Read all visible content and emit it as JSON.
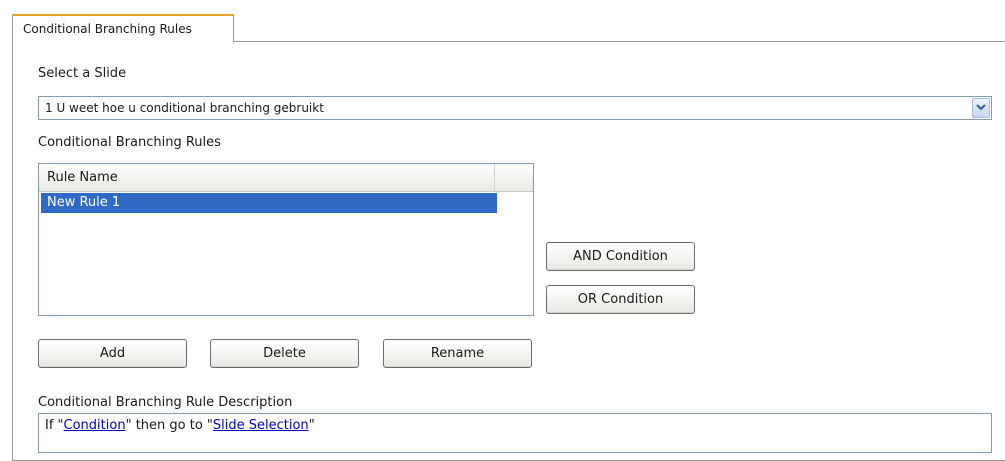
{
  "tab": {
    "label": "Conditional Branching Rules"
  },
  "slide": {
    "label": "Select a Slide",
    "selected": "1 U weet hoe u conditional branching gebruikt"
  },
  "rules": {
    "label": "Conditional Branching Rules",
    "column_header": "Rule Name",
    "items": [
      "New Rule 1"
    ]
  },
  "buttons": {
    "and_condition": "AND Condition",
    "or_condition": "OR Condition",
    "add": "Add",
    "delete": "Delete",
    "rename": "Rename"
  },
  "description": {
    "label": "Conditional Branching Rule Description",
    "if": "If \"",
    "condition_link": "Condition",
    "then": "\" then go to \"",
    "slide_link": "Slide Selection",
    "end": "\""
  },
  "colors": {
    "selection": "#316ac5",
    "tab_accent": "#e6a12a",
    "link": "#0000cc"
  }
}
